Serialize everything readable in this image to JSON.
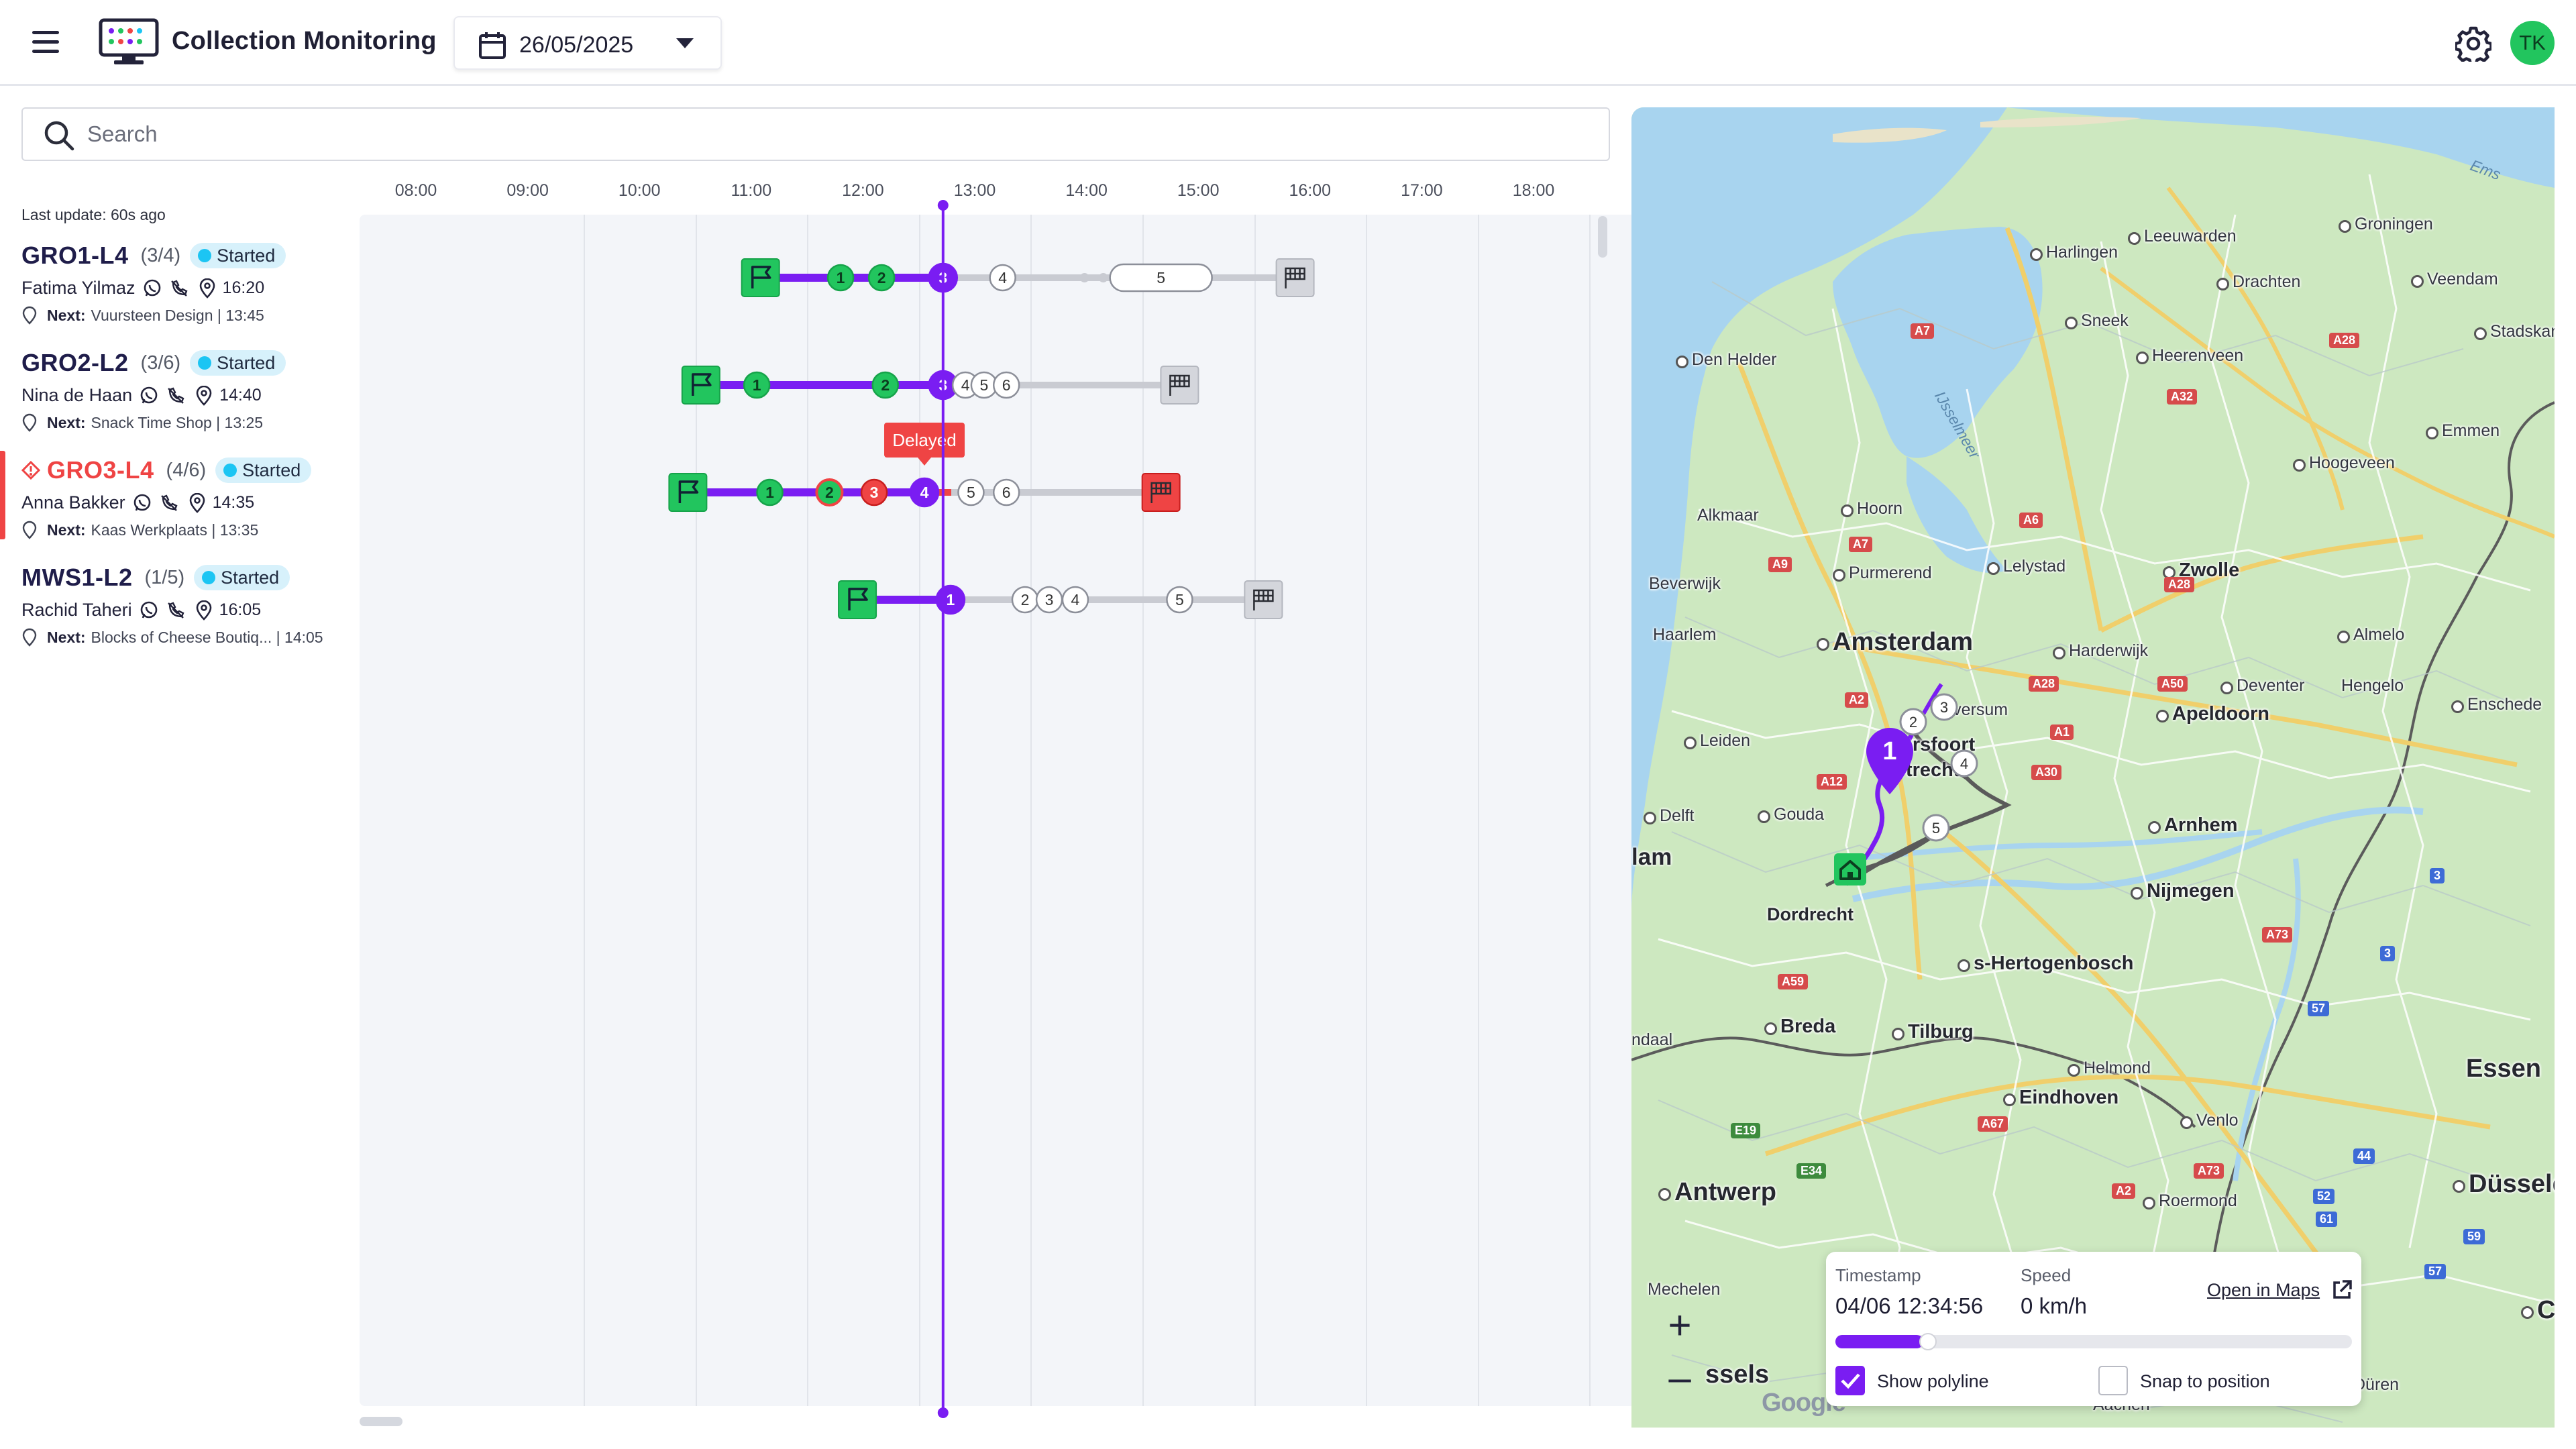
{
  "header": {
    "title": "Collection Monitoring",
    "date": "26/05/2025",
    "avatar_initials": "TK"
  },
  "search": {
    "placeholder": "Search"
  },
  "last_update": "Last update: 60s ago",
  "colors": {
    "accent": "#7a1df2",
    "done": "#22c55e",
    "delayed": "#ef4444",
    "pending": "#c9cbd2",
    "status_badge": "#d7f1fb"
  },
  "routes": [
    {
      "name": "GRO1-L4",
      "progress": "(3/4)",
      "status": "Started",
      "driver": "Fatima Yilmaz",
      "eta": "16:20",
      "next_label": "Next:",
      "next_stop": "Vuursteen Design",
      "next_time": "| 13:45",
      "delayed": false
    },
    {
      "name": "GRO2-L2",
      "progress": "(3/6)",
      "status": "Started",
      "driver": "Nina de Haan",
      "eta": "14:40",
      "next_label": "Next:",
      "next_stop": "Snack Time Shop",
      "next_time": "| 13:25",
      "delayed": false
    },
    {
      "name": "GRO3-L4",
      "progress": "(4/6)",
      "status": "Started",
      "driver": "Anna Bakker",
      "eta": "14:35",
      "next_label": "Next:",
      "next_stop": "Kaas Werkplaats",
      "next_time": "| 13:35",
      "delayed": true
    },
    {
      "name": "MWS1-L2",
      "progress": "(1/5)",
      "status": "Started",
      "driver": "Rachid Taheri",
      "eta": "16:05",
      "next_label": "Next:",
      "next_stop": "Blocks of Cheese Boutiq...",
      "next_time": "| 14:05",
      "delayed": false
    }
  ],
  "timeline": {
    "hours": [
      "08:00",
      "09:00",
      "10:00",
      "11:00",
      "12:00",
      "13:00",
      "14:00",
      "15:00",
      "16:00",
      "17:00",
      "18:00"
    ],
    "now": "12:43",
    "delayed_tooltip": "Delayed",
    "rows": [
      {
        "route": "GRO1-L4",
        "start": "11:05",
        "end": "15:52",
        "stops": [
          {
            "label": "1",
            "time": "11:48",
            "state": "done"
          },
          {
            "label": "2",
            "time": "12:10",
            "state": "done"
          },
          {
            "label": "3",
            "time": "12:43",
            "state": "current"
          },
          {
            "label": "4",
            "time": "13:15",
            "state": "pending"
          },
          {
            "label": "5",
            "time": "14:40",
            "state": "pending-long"
          }
        ]
      },
      {
        "route": "GRO2-L2",
        "start": "10:33",
        "end": "14:50",
        "stops": [
          {
            "label": "1",
            "time": "11:03",
            "state": "done"
          },
          {
            "label": "2",
            "time": "12:12",
            "state": "done"
          },
          {
            "label": "3",
            "time": "12:43",
            "state": "current"
          },
          {
            "label": "4",
            "time": "12:55",
            "state": "pending"
          },
          {
            "label": "5",
            "time": "13:05",
            "state": "pending"
          },
          {
            "label": "6",
            "time": "13:17",
            "state": "pending"
          }
        ]
      },
      {
        "route": "GRO3-L4",
        "start": "10:26",
        "end": "14:40",
        "stops": [
          {
            "label": "1",
            "time": "11:10",
            "state": "done"
          },
          {
            "label": "2",
            "time": "11:42",
            "state": "done-late"
          },
          {
            "label": "3",
            "time": "12:06",
            "state": "late"
          },
          {
            "label": "4",
            "time": "12:33",
            "state": "current"
          },
          {
            "label": "5",
            "time": "12:58",
            "state": "pending"
          },
          {
            "label": "6",
            "time": "13:17",
            "state": "pending"
          }
        ]
      },
      {
        "route": "MWS1-L2",
        "start": "11:57",
        "end": "15:35",
        "stops": [
          {
            "label": "1",
            "time": "12:47",
            "state": "current"
          },
          {
            "label": "2",
            "time": "13:27",
            "state": "pending"
          },
          {
            "label": "3",
            "time": "13:40",
            "state": "pending"
          },
          {
            "label": "4",
            "time": "13:54",
            "state": "pending"
          },
          {
            "label": "5",
            "time": "14:50",
            "state": "pending"
          }
        ]
      }
    ]
  },
  "map": {
    "labels": {
      "amsterdam": "Amsterdam",
      "groningen": "Groningen",
      "leeuwarden": "Leeuwarden",
      "harlingen": "Harlingen",
      "drachten": "Drachten",
      "veendam": "Veendam",
      "sneek": "Sneek",
      "heerenveen": "Heerenveen",
      "stadskanaal": "Stadskanaal",
      "den_helder": "Den Helder",
      "emmen": "Emmen",
      "hoogeveen": "Hoogeveen",
      "alkmaar": "Alkmaar",
      "hoorn": "Hoorn",
      "purmerend": "Purmerend",
      "lelystad": "Lelystad",
      "zwolle": "Zwolle",
      "beverwijk": "Beverwijk",
      "haarlem": "Haarlem",
      "harderwijk": "Harderwijk",
      "almelo": "Almelo",
      "deventer": "Deventer",
      "hengelo": "Hengelo",
      "enschede": "Enschede",
      "leiden": "Leiden",
      "hilversum": "Hilversum",
      "amersfoort": "Amersfoort",
      "apeldoorn": "Apeldoorn",
      "utrecht": "Utrecht",
      "delft": "Delft",
      "gouda": "Gouda",
      "arnhem": "Arnhem",
      "rotterdam": "lam",
      "nijmegen": "Nijmegen",
      "dordrecht": "Dordrecht",
      "hertogenbosch": "s-Hertogenbosch",
      "breda": "Breda",
      "tilburg": "Tilburg",
      "helmond": "Helmond",
      "eindhoven": "Eindhoven",
      "essen": "Essen",
      "venlo": "Venlo",
      "antwerp": "Antwerp",
      "dusseldorf": "Düsseld",
      "roermond": "Roermond",
      "mechelen": "Mechelen",
      "brussels": "ssels",
      "aachen": "Aachen",
      "duren": "Düren",
      "kol": "Co",
      "goes": "ndaal",
      "ijsselmeer": "IJsselmeer",
      "ems": "Ems"
    },
    "route_stops": [
      "1",
      "2",
      "3",
      "4",
      "5"
    ],
    "attribution": "Google",
    "info": {
      "timestamp_label": "Timestamp",
      "timestamp": "04/06 12:34:56",
      "speed_label": "Speed",
      "speed": "0 km/h",
      "open_maps": "Open in Maps",
      "playback_progress": 0.17,
      "show_polyline_label": "Show polyline",
      "show_polyline": true,
      "snap_label": "Snap to position",
      "snap": false
    }
  }
}
